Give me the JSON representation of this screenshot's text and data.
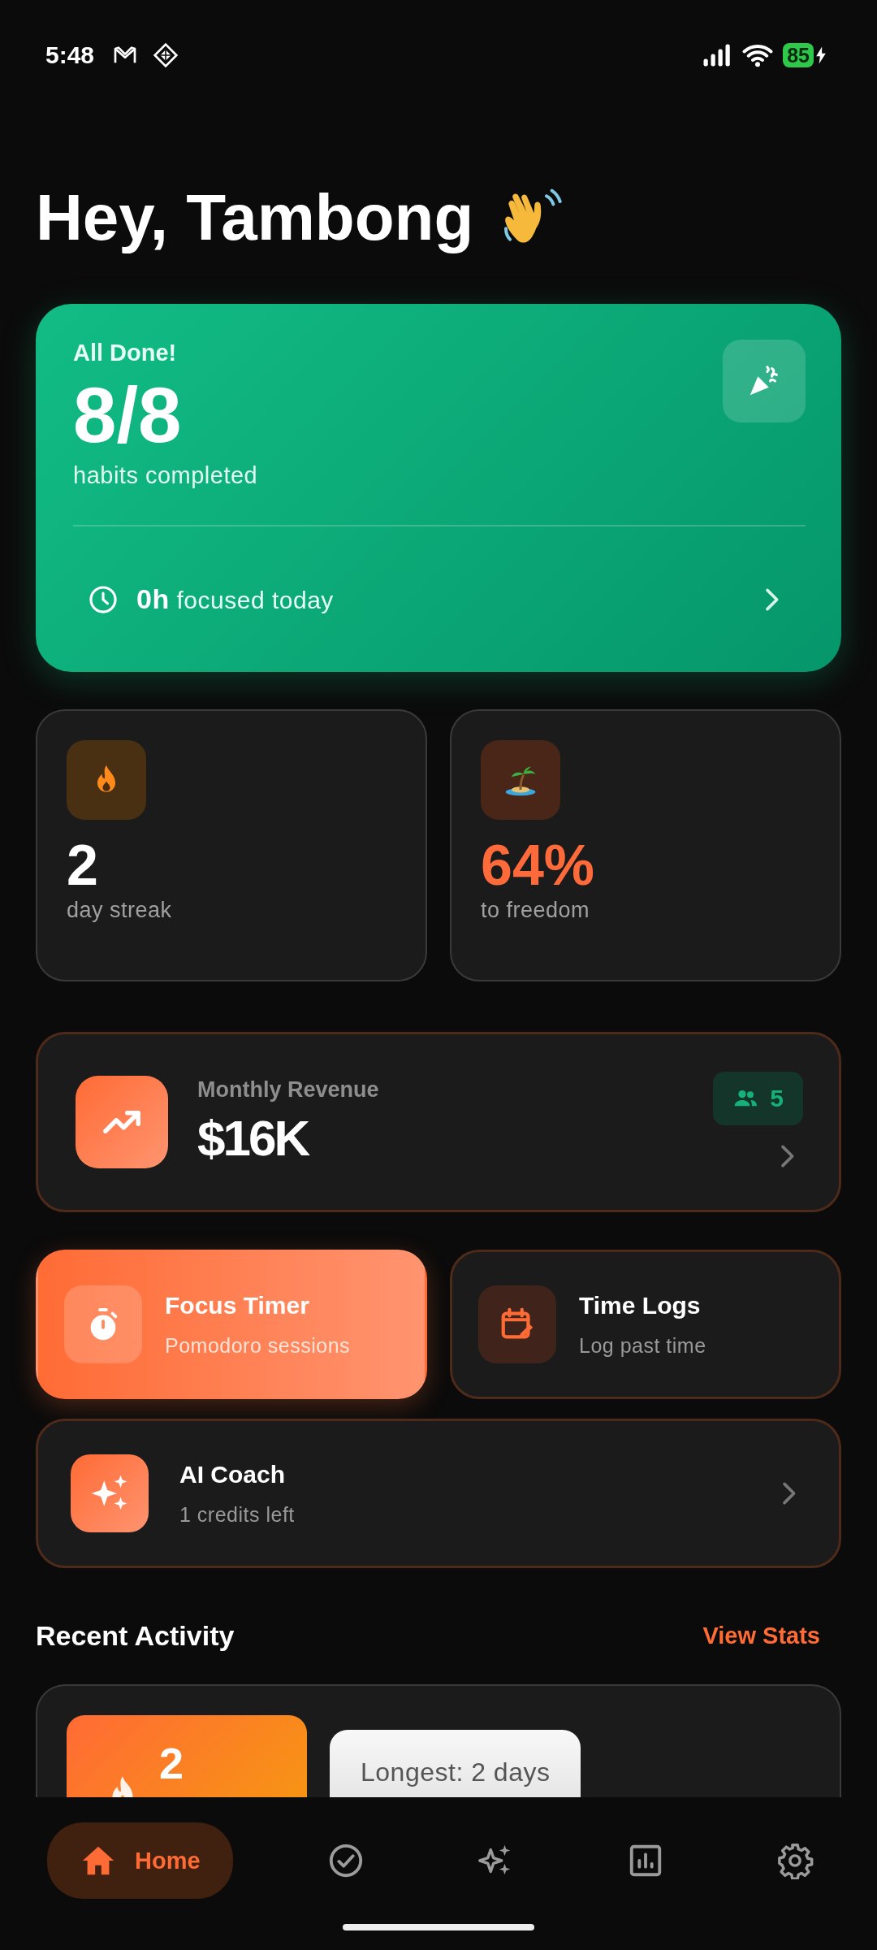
{
  "status_bar": {
    "time": "5:48",
    "battery": "85"
  },
  "greeting": "Hey, Tambong",
  "hero": {
    "label": "All Done!",
    "value": "8/8",
    "caption": "habits completed",
    "focus": "**0h** focused today"
  },
  "stats": [
    {
      "kind": "streak",
      "value": "2",
      "label": "day streak"
    },
    {
      "kind": "freedom",
      "value": "64%",
      "label": "to freedom"
    }
  ],
  "revenue": {
    "label": "Monthly Revenue",
    "value": "$16K",
    "badge": "5"
  },
  "shortcuts": [
    {
      "kind": "timer",
      "title": "Focus Timer",
      "subtitle": "Pomodoro sessions",
      "selected": true
    },
    {
      "kind": "log",
      "title": "Time Logs",
      "subtitle": "Log past time",
      "selected": false
    }
  ],
  "coach": {
    "title": "AI Coach",
    "subtitle": "1 credits left"
  },
  "recent": {
    "title": "Recent Activity",
    "link": "View Stats",
    "streak": "2",
    "longest": "Longest: 2 days"
  },
  "nav": [
    {
      "kind": "home",
      "label": "Home",
      "selected": true
    },
    {
      "kind": "check",
      "selected": false
    },
    {
      "kind": "sparkle",
      "selected": false
    },
    {
      "kind": "chart",
      "selected": false
    },
    {
      "kind": "settings",
      "selected": false
    }
  ]
}
